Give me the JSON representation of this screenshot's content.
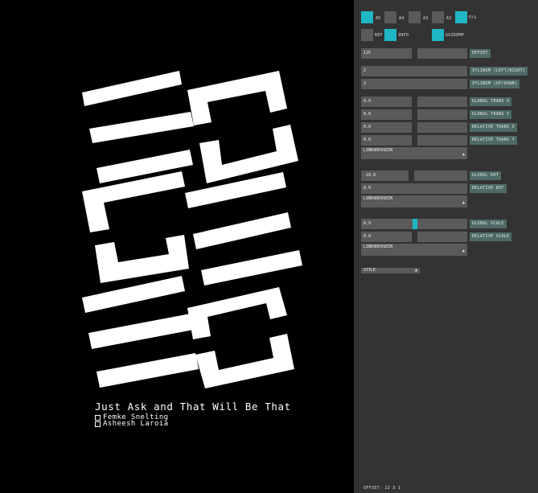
{
  "poster": {
    "title": "Just Ask and That Will Be That",
    "authors": [
      "Femke Snelting",
      "Asheesh Laroia"
    ]
  },
  "panel": {
    "formats": [
      {
        "label": "A5",
        "checked": true
      },
      {
        "label": "A4",
        "checked": false
      },
      {
        "label": "A3",
        "checked": false
      },
      {
        "label": "A2",
        "checked": false
      },
      {
        "label": "P/L",
        "checked": true
      }
    ],
    "flags": [
      {
        "label": "REF",
        "checked": false
      },
      {
        "label": "INFO",
        "checked": true
      },
      {
        "label": "GUIDEMP",
        "checked": true
      }
    ],
    "offset": {
      "value": "125",
      "label": "OFFSET"
    },
    "xylinum_lr": {
      "value": "2",
      "label": "XYLINUM  (LEFT/RIGHT)"
    },
    "xylinum_ud": {
      "value": "2",
      "label": "XYLINUM  (UP/DOWN)"
    },
    "global_trans_x": {
      "value": "0.0",
      "label": "GLOBAL TRANS X"
    },
    "global_trans_y": {
      "value": "0.0",
      "label": "GLOBAL TRANS Y"
    },
    "relative_trans_x": {
      "value": "0.0",
      "label": "RELATIVE TRANS X"
    },
    "relative_trans_y": {
      "value": "0.0",
      "label": "RELATIVE TRANS Y"
    },
    "easing1": "LINEAREASEIN",
    "global_rot": {
      "value": "-10.8",
      "label": "GLOBAL ROT"
    },
    "relative_rot": {
      "value": "0.0",
      "label": "RELATIVE ROT"
    },
    "easing2": "LINEAREASEIN",
    "global_scale": {
      "value": "0.9",
      "label": "GLOBAL SCALE",
      "level": 0.51
    },
    "relative_scale": {
      "value": "0.0",
      "label": "RELATIVE SCALE"
    },
    "easing3": "LINEAREASEIN",
    "style": "STYLE",
    "footer": "OFFSET: 22 X 1"
  },
  "colors": {
    "accent": "#1fb6c6",
    "panel": "#333333",
    "control": "#5a5a5a",
    "tag": "#4d6a66"
  }
}
